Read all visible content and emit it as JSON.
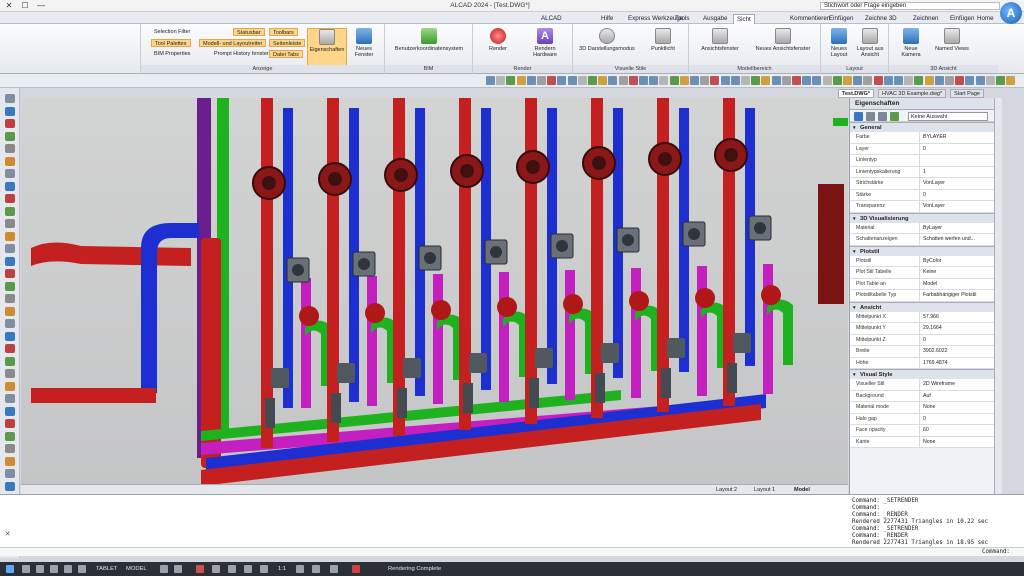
{
  "window": {
    "title": "ALCAD 2024 - [Test.DWG*]",
    "search_placeholder": "Stichwort oder Frage eingeben"
  },
  "menu_tabs": [
    "Home",
    "Einfügen",
    "Zeichnen",
    "Zeichne 3D",
    "Einfügen",
    "Kommentieren",
    "Sicht",
    "Ausgabe",
    "Tools",
    "Express Werkzeuge",
    "Hilfe",
    "ALCAD"
  ],
  "active_tab_index": 6,
  "ribbon": {
    "groups": [
      {
        "label": "3D Ansicht",
        "buttons": [
          "Neue Kamera",
          "Named Views"
        ]
      },
      {
        "label": "Layout",
        "buttons": [
          "Neues Layout",
          "Layout aus Ansicht"
        ]
      },
      {
        "label": "Modellbereich",
        "buttons": [
          "Ansichtsfenster",
          "Neues Ansichtsfenster"
        ]
      },
      {
        "label": "Visuelle Stile",
        "buttons": [
          "3D Darstellungsmodus",
          "Punktlicht"
        ]
      },
      {
        "label": "Render",
        "buttons": [
          "Render",
          "Rendern Hardware"
        ]
      },
      {
        "label": "BIM",
        "buttons": [
          "Benutzerkoordinatensystem"
        ]
      },
      {
        "label": "Anzeige",
        "buttons": [
          "Neues Fenster",
          "Eigenschaften",
          "Toolbars",
          "Statusbar",
          "Seitenleiste",
          "Modell- und Layoutreiter",
          "Prompt History fenster",
          "Datei Tabs",
          "Tool Palettes",
          "BIM Properties",
          "Selection Filter"
        ]
      }
    ]
  },
  "doc_tabs": [
    "Start Page",
    "HVAC 3D Example.dwg*",
    "Test.DWG*"
  ],
  "layout_tabs": [
    "Model",
    "Layout 1",
    "Layout 2"
  ],
  "properties": {
    "title": "Eigenschaften",
    "selector": "Keine Auswahl",
    "sections": [
      {
        "name": "General",
        "rows": [
          {
            "name": "Farbe",
            "value": "BYLAYER"
          },
          {
            "name": "Layer",
            "value": "0"
          },
          {
            "name": "Linientyp",
            "value": ""
          },
          {
            "name": "Linientypskalierung",
            "value": "1"
          },
          {
            "name": "Strichstärke",
            "value": "VonLayer"
          },
          {
            "name": "Stärke",
            "value": "0"
          },
          {
            "name": "Transparenz",
            "value": "VonLayer"
          }
        ]
      },
      {
        "name": "3D Visualisierung",
        "rows": [
          {
            "name": "Material",
            "value": "ByLayer"
          },
          {
            "name": "Schattenanzeigen",
            "value": "Schatten werfen und..."
          }
        ]
      },
      {
        "name": "Plotstil",
        "rows": [
          {
            "name": "Plotstil",
            "value": "ByColor"
          },
          {
            "name": "Plot Stil Tabelle",
            "value": "Keine"
          },
          {
            "name": "Plot Table an",
            "value": "Model"
          },
          {
            "name": "Plotstiltabelle Typ",
            "value": "Farbabhängiger Plotstil"
          }
        ]
      },
      {
        "name": "Ansicht",
        "rows": [
          {
            "name": "Mittelpunkt X",
            "value": "57.966"
          },
          {
            "name": "Mittelpunkt Y",
            "value": "29.1664"
          },
          {
            "name": "Mittelpunkt Z",
            "value": "0"
          },
          {
            "name": "Breite",
            "value": "3902.6022"
          },
          {
            "name": "Höhe",
            "value": "1769.4874"
          }
        ]
      },
      {
        "name": "Visual Style",
        "rows": [
          {
            "name": "Visueller Stil",
            "value": "2D Wireframe"
          },
          {
            "name": "Background",
            "value": "Auf"
          },
          {
            "name": "Material mode",
            "value": "None"
          },
          {
            "name": "Halo gap",
            "value": "0"
          },
          {
            "name": "Face opacity",
            "value": "60"
          },
          {
            "name": "Kante",
            "value": "None"
          }
        ]
      }
    ]
  },
  "command_history": [
    "Command: _SETRENDER",
    "Command:",
    "Command: _RENDER",
    "Rendered 2277431 Triangles in 10.22 sec",
    "Command: _SETRENDER",
    "Command: _RENDER",
    "Rendered 2277431 Triangles in 18.95 sec"
  ],
  "command_prompt": "Command:",
  "status": {
    "model_label": "MODEL",
    "tablet_label": "TABLET",
    "scale": "1:1",
    "message": "Rendering Complete"
  },
  "scene_colors": {
    "red": "#c42020",
    "blue": "#1d2fd1",
    "green": "#1fb21f",
    "magenta": "#c41fbf",
    "violet": "#6a1f8f"
  }
}
